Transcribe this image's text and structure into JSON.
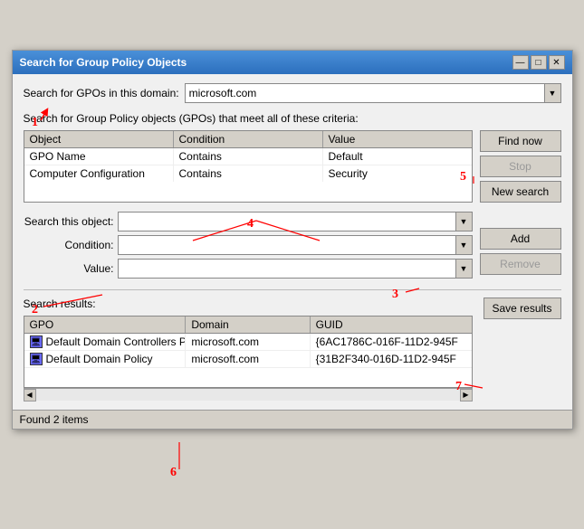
{
  "window": {
    "title": "Search for Group Policy Objects",
    "titleBtns": [
      "—",
      "□",
      "✕"
    ]
  },
  "domain": {
    "label": "Search for GPOs in this domain:",
    "value": "microsoft.com"
  },
  "criteria": {
    "sectionLabel": "Search for Group Policy objects (GPOs) that meet all of these criteria:",
    "table": {
      "headers": [
        "Object",
        "Condition",
        "Value"
      ],
      "rows": [
        [
          "GPO Name",
          "Contains",
          "Default"
        ],
        [
          "Computer Configuration",
          "Contains",
          "Security"
        ]
      ]
    }
  },
  "form": {
    "searchThisObject": {
      "label": "Search this object:",
      "value": ""
    },
    "condition": {
      "label": "Condition:",
      "value": ""
    },
    "value": {
      "label": "Value:",
      "value": ""
    }
  },
  "buttons": {
    "findNow": "Find now",
    "stop": "Stop",
    "newSearch": "New search",
    "add": "Add",
    "remove": "Remove",
    "saveResults": "Save results"
  },
  "results": {
    "label": "Search results:",
    "table": {
      "headers": [
        "GPO",
        "Domain",
        "GUID"
      ],
      "rows": [
        {
          "gpo": "Default Domain Controllers Policy",
          "domain": "microsoft.com",
          "guid": "{6AC1786C-016F-11D2-945F"
        },
        {
          "gpo": "Default Domain Policy",
          "domain": "microsoft.com",
          "guid": "{31B2F340-016D-11D2-945F"
        }
      ]
    }
  },
  "status": {
    "text": "Found 2 items"
  },
  "annotations": {
    "numbers": [
      "1",
      "2",
      "3",
      "4",
      "5",
      "6",
      "7"
    ]
  }
}
